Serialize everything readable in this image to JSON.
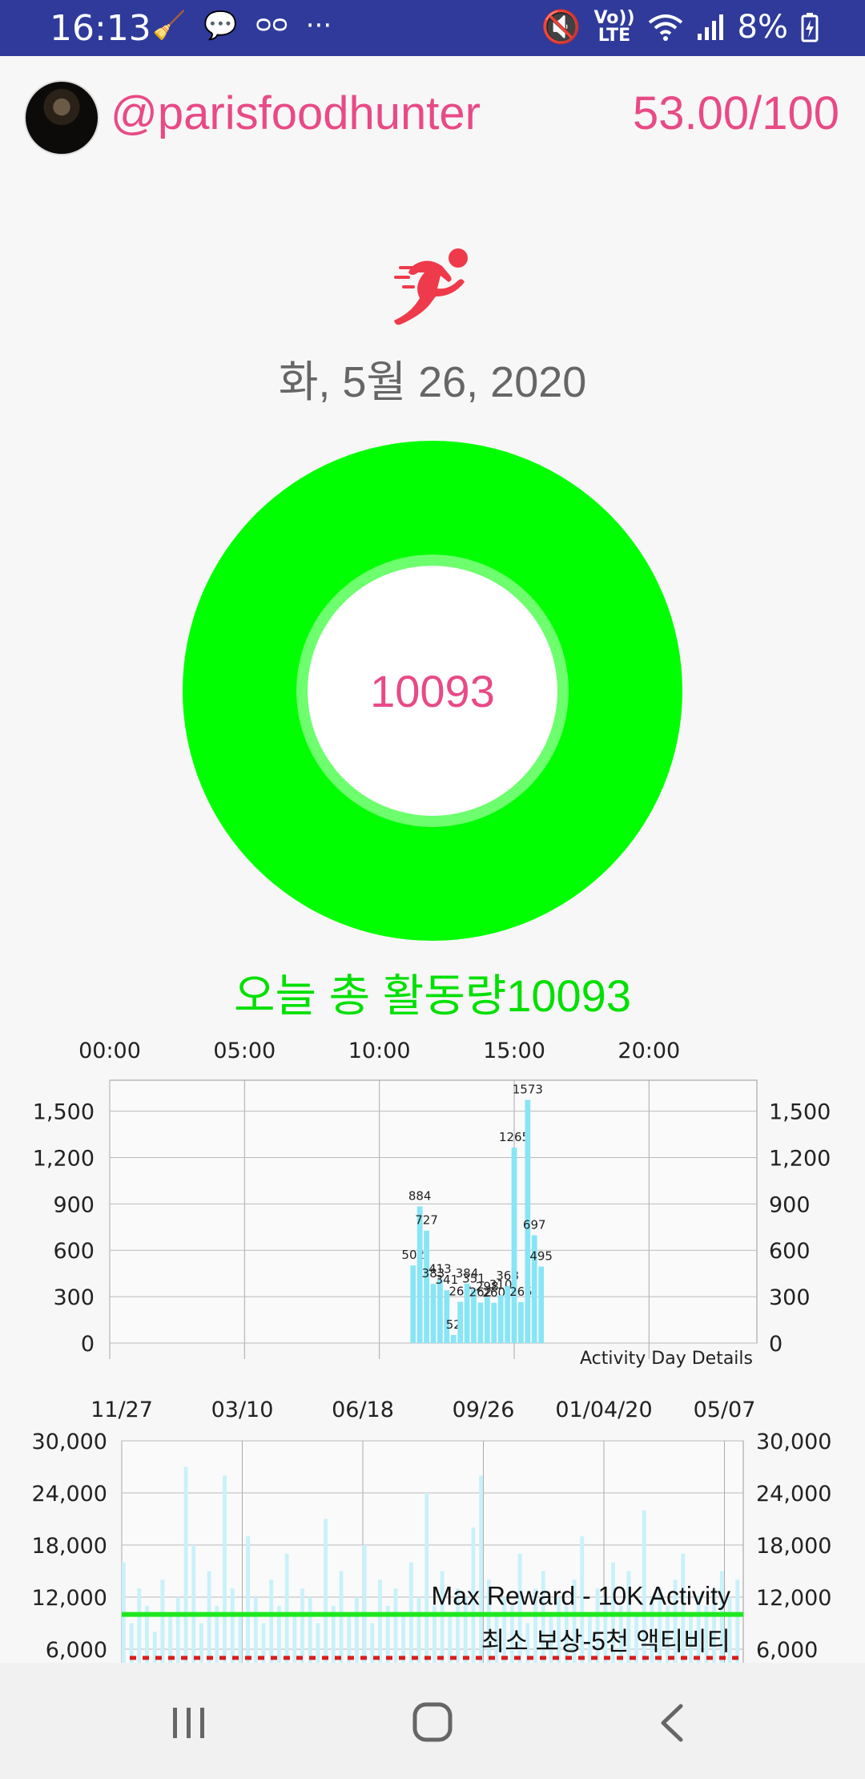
{
  "status_bar": {
    "time": "16:13",
    "left_icons": [
      "broom-icon",
      "chat-bubble-icon",
      "voicemail-icon",
      "more-dots-icon"
    ],
    "volte_line1": "Vo))",
    "volte_line2": "LTE",
    "battery": "8%"
  },
  "header": {
    "username": "@parisfoodhunter",
    "score": "53.00/100"
  },
  "date": "화, 5월 26, 2020",
  "ring": {
    "value": "10093",
    "progress_fraction": 1.0,
    "color": "#00ff00"
  },
  "total_activity": "오늘 총 활동량10093",
  "colors": {
    "accent": "#e84a86",
    "ring_green": "#00ff00",
    "bar_blue": "#87e5f6",
    "max_line": "#1ee81e",
    "min_line": "#d91e1e"
  },
  "day_chart": {
    "chart_data": {
      "type": "bar",
      "title": "",
      "legend": "Activity Day Details",
      "x_ticks": [
        "00:00",
        "05:00",
        "10:00",
        "15:00",
        "20:00"
      ],
      "x_tick_hours": [
        0,
        5,
        10,
        15,
        20
      ],
      "xlim_hours": [
        0,
        24
      ],
      "y_ticks": [
        "1,500",
        "1,200",
        "900",
        "600",
        "300",
        "0"
      ],
      "ylim": [
        0,
        1700
      ],
      "grid": true,
      "bars": [
        {
          "hour": 11.25,
          "value": 502,
          "label": "502"
        },
        {
          "hour": 11.5,
          "value": 884,
          "label": "884"
        },
        {
          "hour": 11.75,
          "value": 727,
          "label": "727"
        },
        {
          "hour": 12.0,
          "value": 383,
          "label": "383"
        },
        {
          "hour": 12.25,
          "value": 413,
          "label": "413"
        },
        {
          "hour": 12.5,
          "value": 341,
          "label": "341"
        },
        {
          "hour": 12.75,
          "value": 52,
          "label": "52"
        },
        {
          "hour": 13.0,
          "value": 267,
          "label": "267"
        },
        {
          "hour": 13.25,
          "value": 384,
          "label": "384"
        },
        {
          "hour": 13.5,
          "value": 351,
          "label": "351"
        },
        {
          "hour": 13.75,
          "value": 262,
          "label": "262"
        },
        {
          "hour": 14.0,
          "value": 298,
          "label": "298"
        },
        {
          "hour": 14.25,
          "value": 260,
          "label": "260"
        },
        {
          "hour": 14.5,
          "value": 310,
          "label": "310"
        },
        {
          "hour": 14.75,
          "value": 368,
          "label": "368"
        },
        {
          "hour": 15.0,
          "value": 1265,
          "label": "1265"
        },
        {
          "hour": 15.25,
          "value": 265,
          "label": "265"
        },
        {
          "hour": 15.5,
          "value": 1573,
          "label": "1573"
        },
        {
          "hour": 15.75,
          "value": 697,
          "label": "697"
        },
        {
          "hour": 16.0,
          "value": 495,
          "label": "495"
        }
      ]
    }
  },
  "history_chart": {
    "chart_data": {
      "type": "bar",
      "title": "",
      "x_ticks": [
        "11/27",
        "03/10",
        "06/18",
        "09/26",
        "01/04/20",
        "05/07"
      ],
      "y_ticks": [
        "30,000",
        "24,000",
        "18,000",
        "12,000",
        "6,000"
      ],
      "ylim": [
        0,
        30000
      ],
      "grid": true,
      "max_line": {
        "label": "Max Reward - 10K Activity",
        "value": 10000
      },
      "min_line": {
        "label": "최소 보상-5천 액티비티",
        "value": 5000
      },
      "values": [
        16000,
        9000,
        13000,
        11000,
        8000,
        14000,
        10000,
        12000,
        27000,
        18000,
        9000,
        15000,
        11000,
        26000,
        13000,
        10000,
        19000,
        12000,
        9000,
        14000,
        11000,
        17000,
        10000,
        13000,
        12000,
        9000,
        21000,
        11000,
        15000,
        10000,
        12000,
        18000,
        9000,
        14000,
        11000,
        13000,
        10000,
        16000,
        12000,
        24000,
        11000,
        15000,
        10000,
        13000,
        12000,
        20000,
        26000,
        14000,
        10000,
        12000,
        11000,
        17000,
        9000,
        13000,
        15000,
        10000,
        12000,
        11000,
        14000,
        19000,
        10000,
        13000,
        12000,
        16000,
        11000,
        15000,
        10000,
        22000,
        12000,
        13000,
        11000,
        14000,
        17000,
        10000,
        12000,
        11000,
        13000,
        15000,
        12000,
        14000
      ]
    }
  },
  "nav_bar": {
    "recents": "recents-icon",
    "home": "home-icon",
    "back": "back-icon"
  }
}
